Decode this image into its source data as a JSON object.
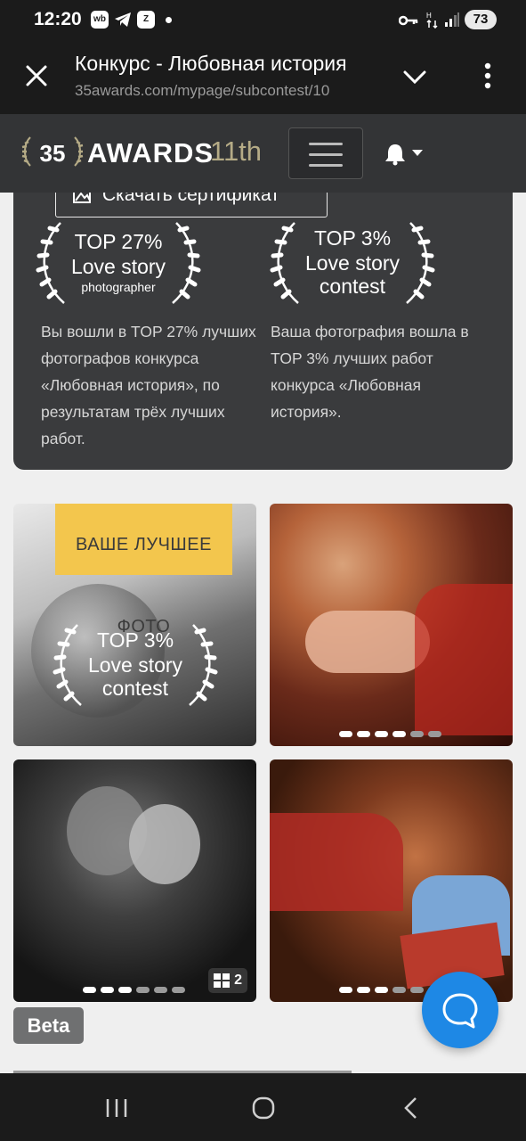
{
  "status_bar": {
    "time": "12:20",
    "notif_icons": [
      "wb",
      "telegram",
      "zen"
    ],
    "battery": "73"
  },
  "browser": {
    "title": "Конкурс - Любовная история",
    "url": "35awards.com/mypage/subcontest/10"
  },
  "header": {
    "logo_text": "35",
    "brand": "AWARDS",
    "edition": "11th"
  },
  "results": {
    "certificate_button": "Скачать сертификат",
    "badges": [
      {
        "line1": "TOP 27%",
        "line2": "Love story",
        "line3": "photographer",
        "description": "Вы вошли в TOP 27% лучших фотографов конкурса «Любовная история», по результатам трёх лучших работ."
      },
      {
        "line1": "TOP 3%",
        "line2": "Love story",
        "line3": "contest",
        "description": "Ваша фотография вошла в TOP 3% лучших работ конкурса «Любовная история»."
      }
    ]
  },
  "gallery": {
    "best_photo_label": "ВАШЕ ЛУЧШЕЕ ФОТО",
    "best_badge": {
      "line1": "TOP 3%",
      "line2": "Love story",
      "line3": "contest"
    },
    "tiles": [
      {
        "dots": 0,
        "active": 0
      },
      {
        "dots": 6,
        "active": 4
      },
      {
        "dots": 6,
        "active": 3,
        "count": "2"
      },
      {
        "dots": 6,
        "active": 3
      }
    ]
  },
  "beta_label": "Beta",
  "colors": {
    "accent": "#f3c64d",
    "chat": "#1e88e5",
    "header": "#333436",
    "card": "#3a3b3d"
  }
}
